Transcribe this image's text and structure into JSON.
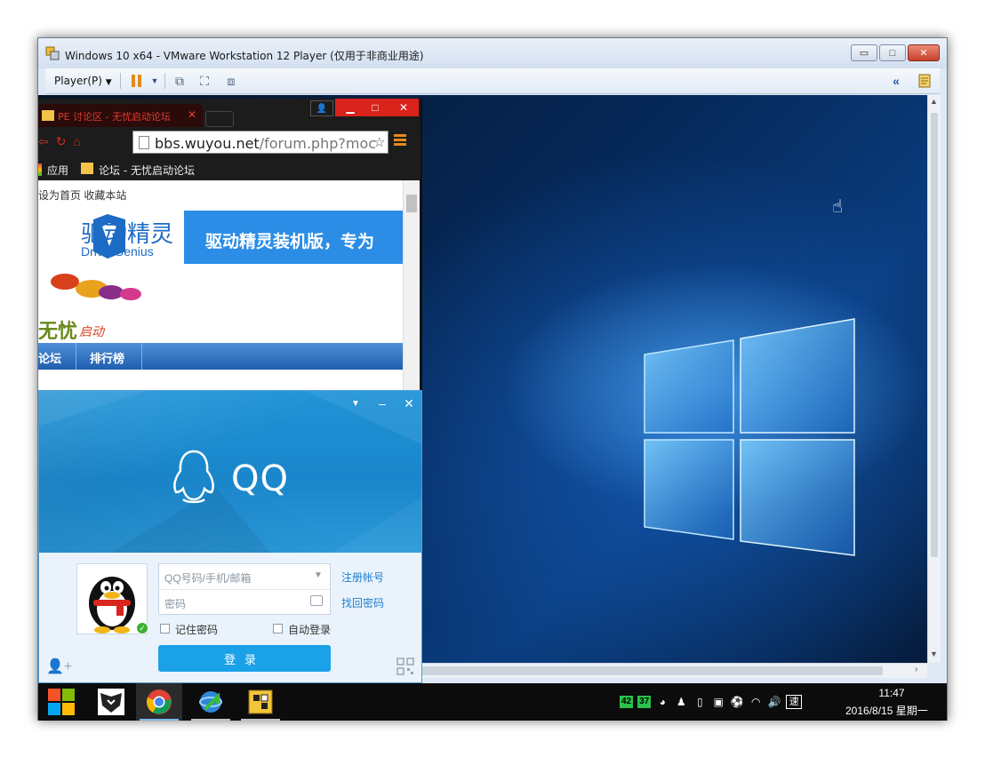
{
  "vmware": {
    "title": "Windows 10 x64 - VMware Workstation 12 Player (仅用于非商业用途)",
    "player_menu": "Player(P)"
  },
  "chrome": {
    "tab_title": "PE 讨论区 - 无忧启动论坛",
    "tab_close": "✕",
    "address_host": "bbs.wuyou.net",
    "address_path": "/forum.php?moc",
    "bookmark_apps": "应用",
    "bookmark_forum": "论坛 - 无忧启动论坛",
    "page": {
      "top_links": "设为首页  收藏本站",
      "dg_name": "驱动精灵",
      "dg_sub": "DriverGenius",
      "dg_banner": "驱动精灵装机版，专为",
      "wy_name": "无忧",
      "wy_sub": "启动",
      "nav": [
        "论坛",
        "排行榜"
      ]
    }
  },
  "qq": {
    "logo_text": "QQ",
    "username_placeholder": "QQ号码/手机/邮箱",
    "password_placeholder": "密码",
    "register_link": "注册帐号",
    "recover_link": "找回密码",
    "remember_label": "记住密码",
    "autologin_label": "自动登录",
    "login_button": "登录"
  },
  "taskbar": {
    "tray_num1": "42",
    "tray_num2": "37",
    "ime": "速",
    "time": "11:47",
    "date": "2016/8/15 星期一"
  },
  "colors": {
    "taskbar": "#0c0c0c",
    "qq_blue": "#1a86cb",
    "login_button": "#1aa1e8",
    "chrome_accent": "#d9231b",
    "desktop_blue": "#0a3c7e"
  }
}
